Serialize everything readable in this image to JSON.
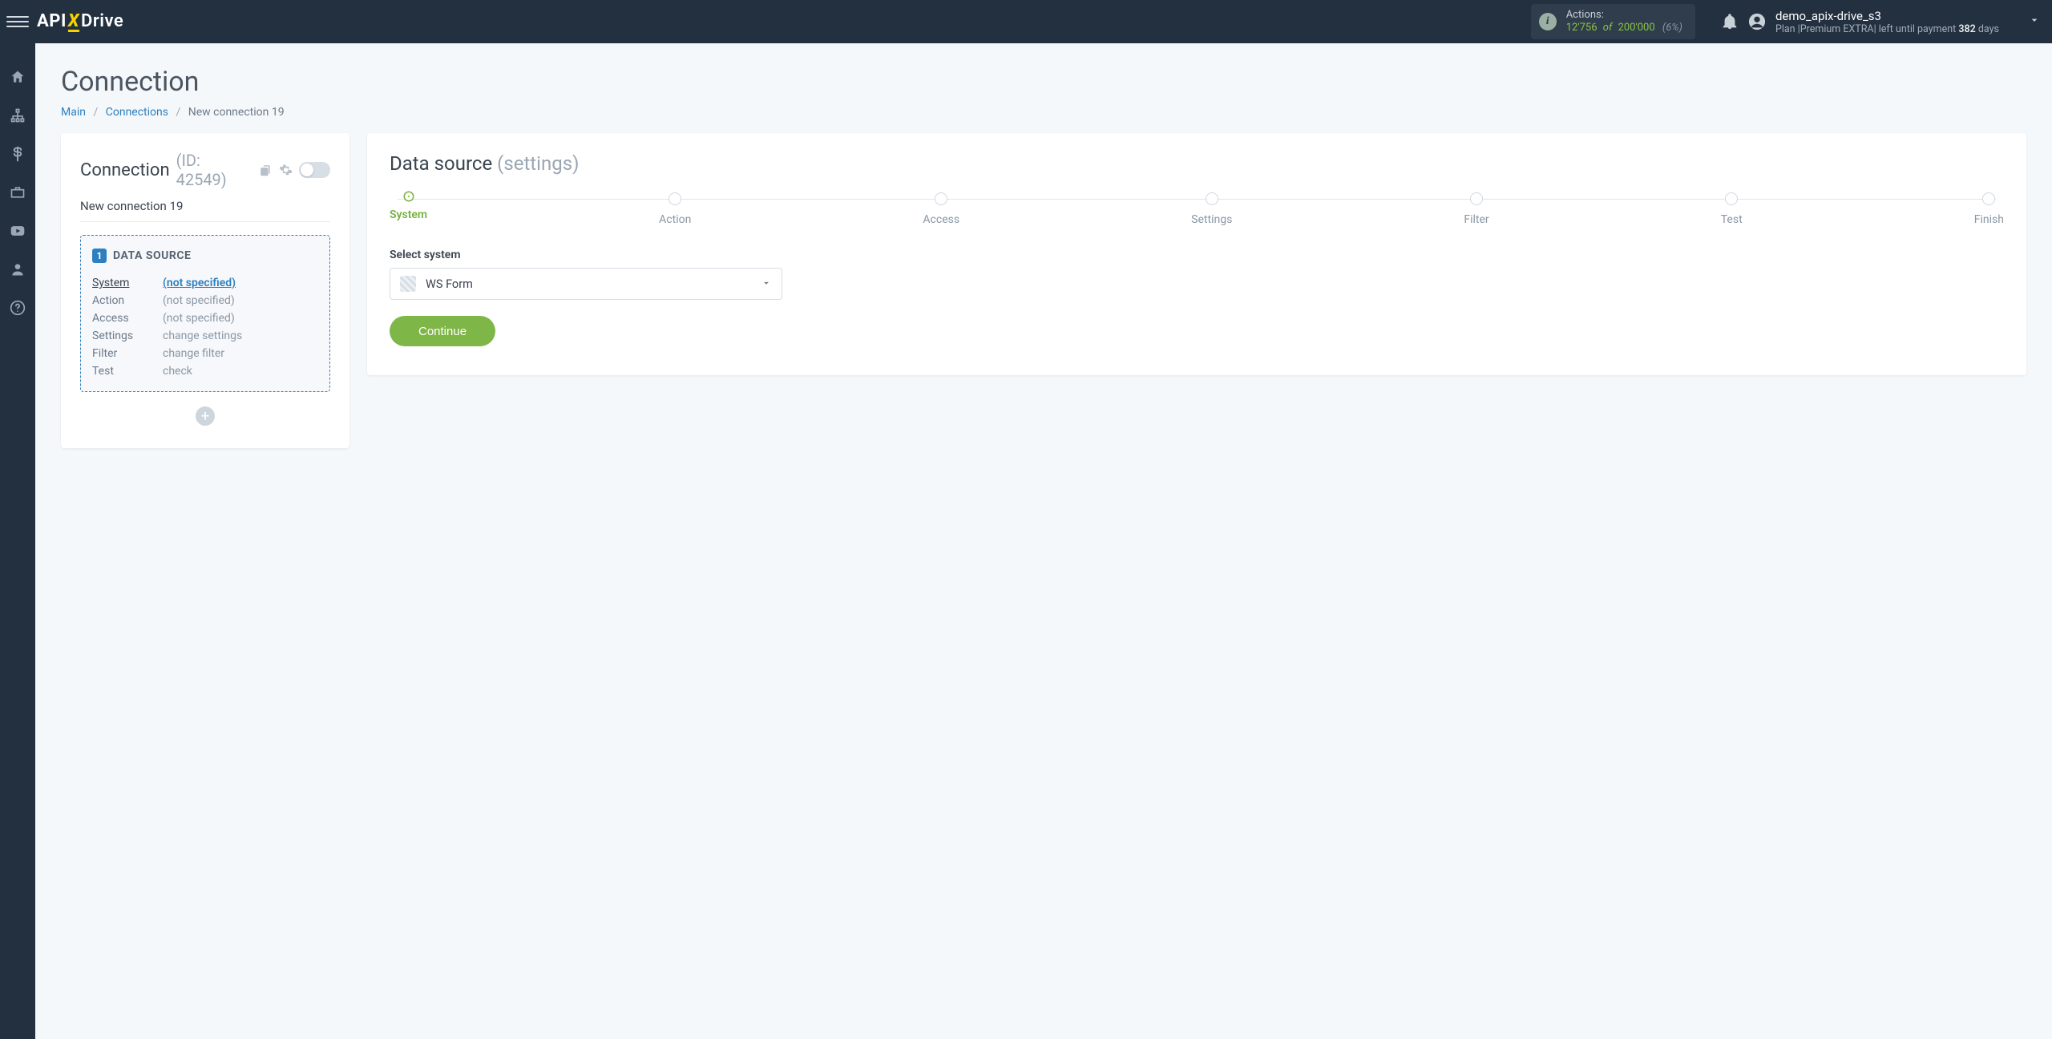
{
  "brand": {
    "part1": "API",
    "x": "X",
    "part2": "Drive"
  },
  "topbar": {
    "actions_label": "Actions:",
    "actions_used": "12'756",
    "actions_of": "of",
    "actions_total": "200'000",
    "actions_pct": "(6%)",
    "user_name": "demo_apix-drive_s3",
    "plan_prefix": "Plan ",
    "plan_name": "|Premium EXTRA|",
    "plan_mid": " left until payment ",
    "plan_days": "382",
    "plan_suffix": " days"
  },
  "page": {
    "title": "Connection",
    "crumbs": {
      "main": "Main",
      "connections": "Connections",
      "current": "New connection 19"
    }
  },
  "left_card": {
    "title": "Connection",
    "id_label": "(ID: 42549)",
    "name": "New connection 19",
    "source": {
      "badge": "1",
      "heading": "DATA SOURCE",
      "rows": [
        {
          "k": "System",
          "v": "(not specified)",
          "k_active": true,
          "v_link": true
        },
        {
          "k": "Action",
          "v": "(not specified)",
          "k_active": false,
          "v_link": false
        },
        {
          "k": "Access",
          "v": "(not specified)",
          "k_active": false,
          "v_link": false
        },
        {
          "k": "Settings",
          "v": "change settings",
          "k_active": false,
          "v_link": false
        },
        {
          "k": "Filter",
          "v": "change filter",
          "k_active": false,
          "v_link": false
        },
        {
          "k": "Test",
          "v": "check",
          "k_active": false,
          "v_link": false
        }
      ]
    }
  },
  "right_card": {
    "title": "Data source",
    "subtitle": "(settings)",
    "steps": [
      "System",
      "Action",
      "Access",
      "Settings",
      "Filter",
      "Test",
      "Finish"
    ],
    "active_step_index": 0,
    "select_label": "Select system",
    "selected_system": "WS Form",
    "continue_label": "Continue"
  }
}
